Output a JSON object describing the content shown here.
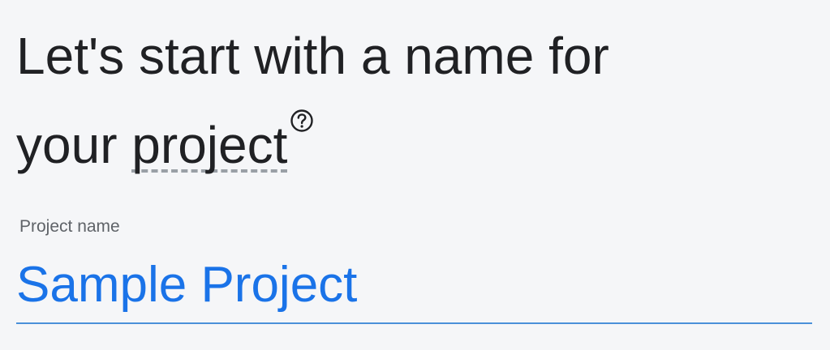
{
  "heading": {
    "line1": "Let's start with a name for",
    "prefix": "your ",
    "term": "project",
    "help_icon": "help-circle-icon"
  },
  "project_name_field": {
    "label": "Project name",
    "value": "Sample Project"
  },
  "colors": {
    "background": "#f5f6f8",
    "heading_text": "#202124",
    "label_text": "#5f6368",
    "input_text": "#1a73e8",
    "input_underline": "#4a90d9",
    "term_underline": "#9aa0a6"
  }
}
